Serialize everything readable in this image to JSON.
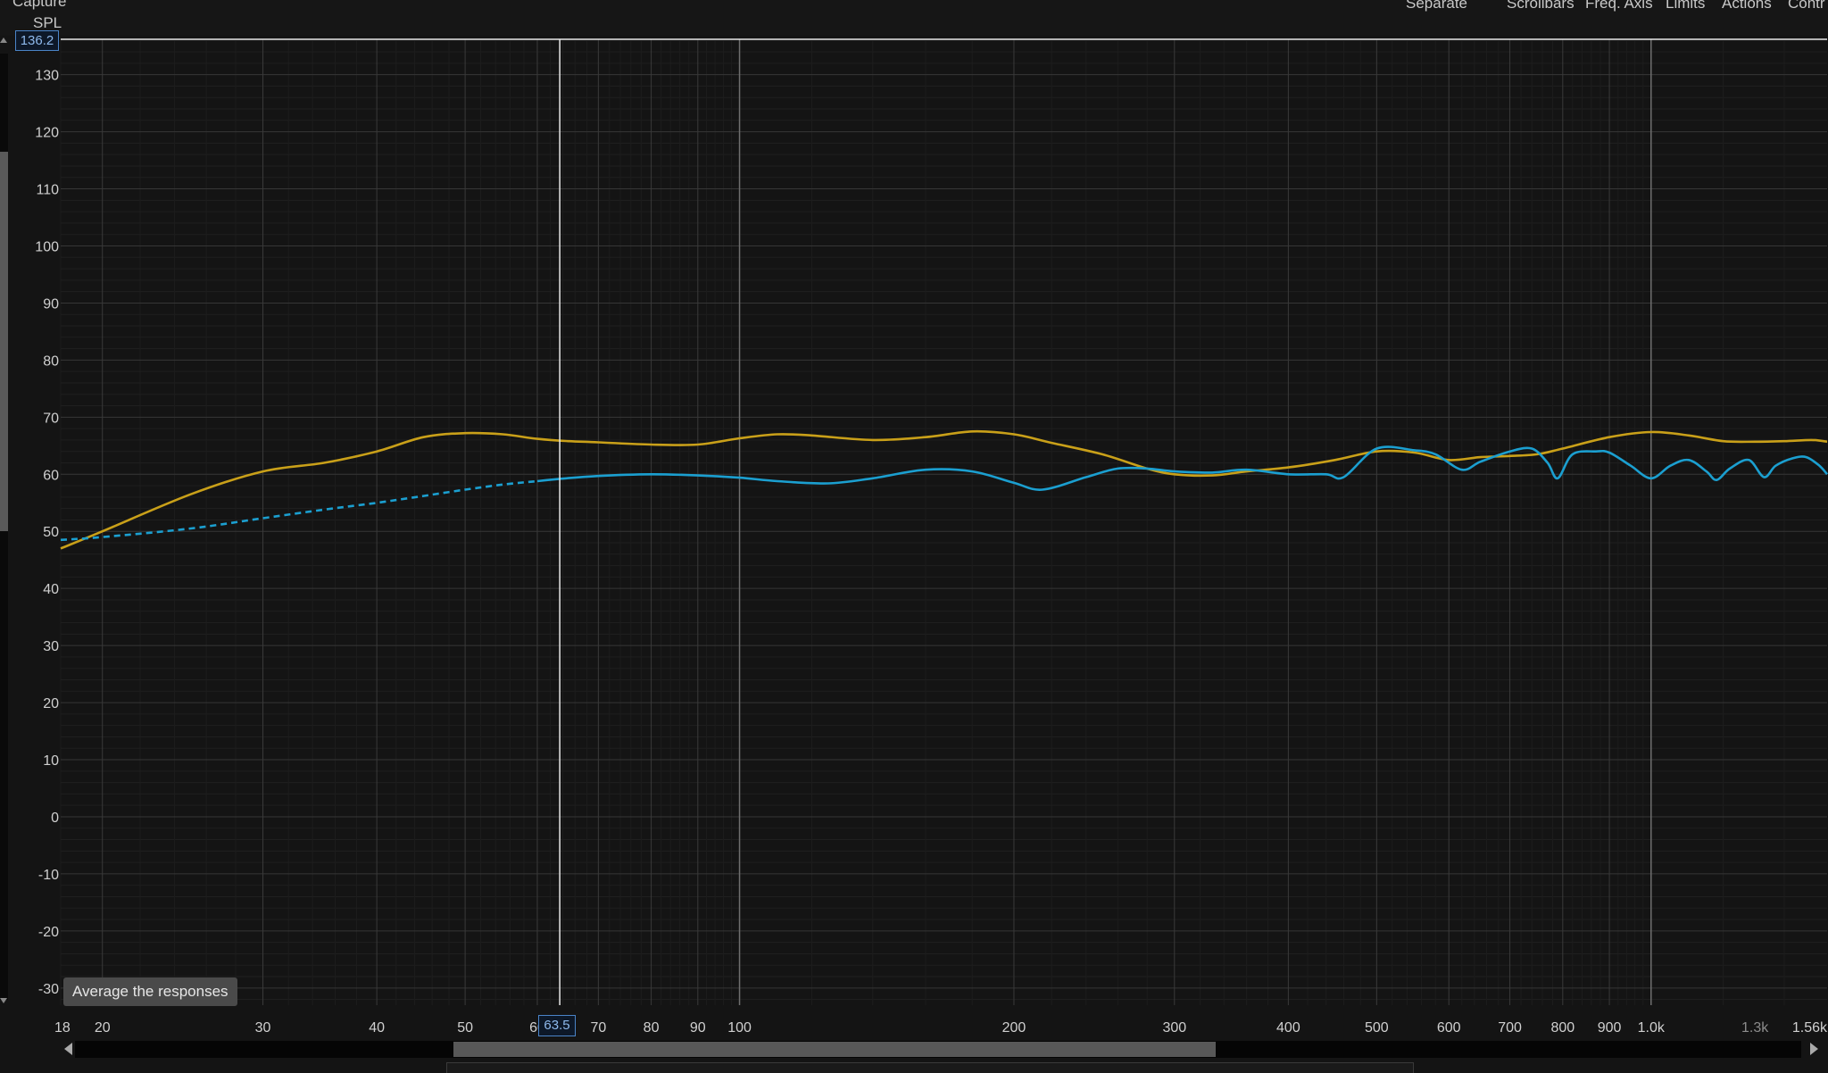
{
  "window": {
    "capture_label": "Capture",
    "spl_label": "SPL",
    "toolbar": {
      "separate": "Separate",
      "scrollbars": "Scrollbars",
      "freq_axis": "Freq. Axis",
      "limits": "Limits",
      "actions": "Actions",
      "controls": "Contr"
    },
    "cursor": {
      "y_value": "136.2",
      "x_value": "63.5"
    },
    "tooltip": "Average the responses"
  },
  "chart_data": {
    "type": "line",
    "x_scale": "log",
    "xlim": [
      18,
      1560
    ],
    "ylim": [
      -33,
      136.2
    ],
    "grid": true,
    "xlabel": "",
    "ylabel": "SPL",
    "y_ticks": [
      130,
      120,
      110,
      100,
      90,
      80,
      70,
      60,
      50,
      40,
      30,
      20,
      10,
      0,
      -10,
      -20,
      -30
    ],
    "x_tick_labels": [
      {
        "v": 18,
        "t": "18"
      },
      {
        "v": 20,
        "t": "20"
      },
      {
        "v": 30,
        "t": "30"
      },
      {
        "v": 40,
        "t": "40"
      },
      {
        "v": 50,
        "t": "50"
      },
      {
        "v": 60,
        "t": "60"
      },
      {
        "v": 70,
        "t": "70"
      },
      {
        "v": 80,
        "t": "80"
      },
      {
        "v": 90,
        "t": "90"
      },
      {
        "v": 100,
        "t": "100"
      },
      {
        "v": 200,
        "t": "200"
      },
      {
        "v": 300,
        "t": "300"
      },
      {
        "v": 400,
        "t": "400"
      },
      {
        "v": 500,
        "t": "500"
      },
      {
        "v": 600,
        "t": "600"
      },
      {
        "v": 700,
        "t": "700"
      },
      {
        "v": 800,
        "t": "800"
      },
      {
        "v": 900,
        "t": "900"
      },
      {
        "v": 1000,
        "t": "1.0k"
      },
      {
        "v": 1300,
        "t": "1.3k"
      },
      {
        "v": 1560,
        "t": "1.56k"
      }
    ],
    "cursor_x": 63.5,
    "cursor_y": 136.2,
    "series": [
      {
        "color": "#c9a019",
        "dashed_below": null,
        "points": [
          [
            18,
            47
          ],
          [
            20,
            50
          ],
          [
            25,
            56.5
          ],
          [
            30,
            60.5
          ],
          [
            35,
            62
          ],
          [
            40,
            64
          ],
          [
            45,
            66.5
          ],
          [
            50,
            67.2
          ],
          [
            55,
            67
          ],
          [
            60,
            66.2
          ],
          [
            65,
            65.8
          ],
          [
            70,
            65.6
          ],
          [
            80,
            65.2
          ],
          [
            90,
            65.2
          ],
          [
            100,
            66.3
          ],
          [
            110,
            67
          ],
          [
            120,
            66.8
          ],
          [
            140,
            66
          ],
          [
            160,
            66.5
          ],
          [
            180,
            67.5
          ],
          [
            200,
            67
          ],
          [
            220,
            65.5
          ],
          [
            250,
            63.5
          ],
          [
            280,
            61
          ],
          [
            300,
            60
          ],
          [
            330,
            59.8
          ],
          [
            360,
            60.5
          ],
          [
            400,
            61.2
          ],
          [
            450,
            62.5
          ],
          [
            500,
            64
          ],
          [
            550,
            63.8
          ],
          [
            600,
            62.5
          ],
          [
            650,
            63
          ],
          [
            700,
            63.2
          ],
          [
            750,
            63.5
          ],
          [
            800,
            64.5
          ],
          [
            900,
            66.5
          ],
          [
            1000,
            67.4
          ],
          [
            1100,
            66.8
          ],
          [
            1200,
            65.8
          ],
          [
            1300,
            65.7
          ],
          [
            1400,
            65.8
          ],
          [
            1500,
            66
          ],
          [
            1560,
            65.7
          ]
        ]
      },
      {
        "color": "#1b9fd0",
        "dashed_below": 60,
        "points": [
          [
            18,
            48.5
          ],
          [
            20,
            49
          ],
          [
            25,
            50.5
          ],
          [
            30,
            52.3
          ],
          [
            35,
            53.8
          ],
          [
            40,
            55
          ],
          [
            45,
            56.2
          ],
          [
            50,
            57.3
          ],
          [
            55,
            58.2
          ],
          [
            60,
            58.8
          ],
          [
            63.5,
            59.2
          ],
          [
            70,
            59.7
          ],
          [
            80,
            60
          ],
          [
            90,
            59.8
          ],
          [
            100,
            59.4
          ],
          [
            110,
            58.8
          ],
          [
            125,
            58.4
          ],
          [
            140,
            59.3
          ],
          [
            160,
            60.8
          ],
          [
            180,
            60.5
          ],
          [
            200,
            58.5
          ],
          [
            215,
            57.3
          ],
          [
            240,
            59.5
          ],
          [
            260,
            61
          ],
          [
            280,
            61
          ],
          [
            300,
            60.5
          ],
          [
            330,
            60.3
          ],
          [
            360,
            60.8
          ],
          [
            400,
            60
          ],
          [
            440,
            60
          ],
          [
            460,
            59.5
          ],
          [
            500,
            64.5
          ],
          [
            550,
            64.2
          ],
          [
            580,
            63.5
          ],
          [
            620,
            60.8
          ],
          [
            650,
            62.2
          ],
          [
            700,
            64
          ],
          [
            740,
            64.5
          ],
          [
            770,
            62
          ],
          [
            790,
            59.3
          ],
          [
            820,
            63.5
          ],
          [
            870,
            64
          ],
          [
            900,
            63.8
          ],
          [
            950,
            61.5
          ],
          [
            1000,
            59.3
          ],
          [
            1050,
            61.5
          ],
          [
            1100,
            62.5
          ],
          [
            1150,
            60.5
          ],
          [
            1180,
            59
          ],
          [
            1220,
            61
          ],
          [
            1280,
            62.5
          ],
          [
            1330,
            59.5
          ],
          [
            1370,
            61.5
          ],
          [
            1430,
            62.8
          ],
          [
            1480,
            63
          ],
          [
            1530,
            61.5
          ],
          [
            1560,
            60
          ]
        ]
      }
    ]
  }
}
